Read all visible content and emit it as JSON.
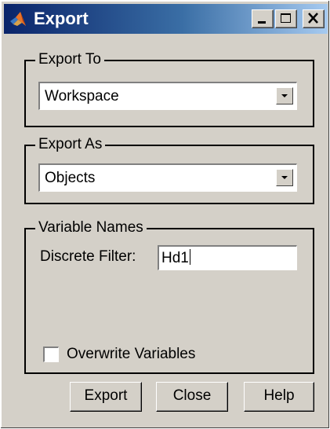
{
  "window": {
    "title": "Export"
  },
  "titlebar_buttons": {
    "minimize_icon": "minimize-icon",
    "maximize_icon": "maximize-icon",
    "close_icon": "close-icon"
  },
  "export_to": {
    "label": "Export To",
    "selected": "Workspace"
  },
  "export_as": {
    "label": "Export As",
    "selected": "Objects"
  },
  "variable_names": {
    "label": "Variable Names",
    "discrete_filter_label": "Discrete Filter:",
    "discrete_filter_value": "Hd1",
    "overwrite_label": "Overwrite Variables",
    "overwrite_checked": false
  },
  "buttons": {
    "export_label": "Export",
    "close_label": "Close",
    "help_label": "Help"
  },
  "colors": {
    "titlebar_start": "#0a246a",
    "titlebar_end": "#a6caf0",
    "dialog_bg": "#d4d0c8"
  }
}
